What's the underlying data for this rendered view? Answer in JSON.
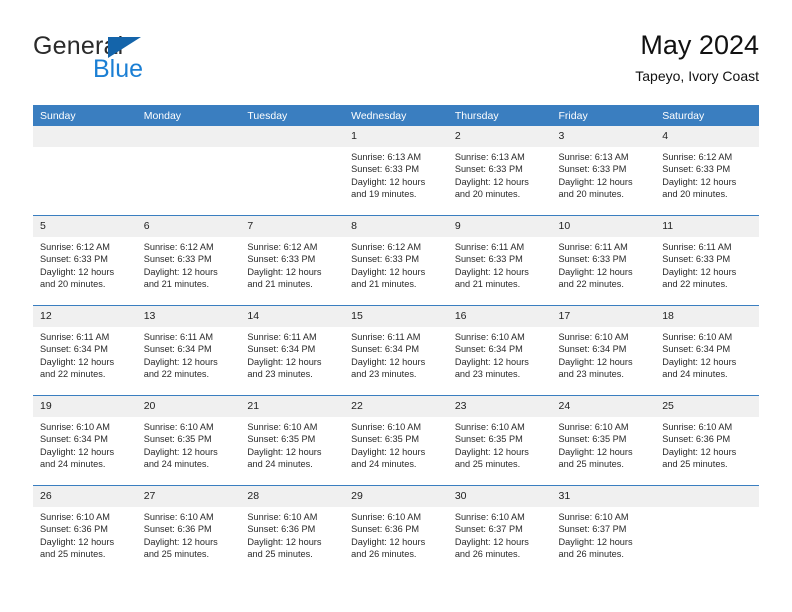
{
  "brand": {
    "name_part1": "General",
    "name_part2": "Blue",
    "triangle_icon": "blue-triangle-icon",
    "accent_color": "#1b7fd4"
  },
  "header": {
    "title": "May 2024",
    "subtitle": "Tapeyo, Ivory Coast"
  },
  "theme": {
    "header_row_bg": "#3a7ec0",
    "daynum_bg": "#f0f0f0",
    "grid_line": "#3a7ec0",
    "text": "#2a2a2a"
  },
  "weekdays": [
    "Sunday",
    "Monday",
    "Tuesday",
    "Wednesday",
    "Thursday",
    "Friday",
    "Saturday"
  ],
  "weeks": [
    [
      {
        "day": "",
        "sunrise": "",
        "sunset": "",
        "daylight": "",
        "empty": true
      },
      {
        "day": "",
        "sunrise": "",
        "sunset": "",
        "daylight": "",
        "empty": true
      },
      {
        "day": "",
        "sunrise": "",
        "sunset": "",
        "daylight": "",
        "empty": true
      },
      {
        "day": "1",
        "sunrise": "Sunrise: 6:13 AM",
        "sunset": "Sunset: 6:33 PM",
        "daylight": "Daylight: 12 hours and 19 minutes.",
        "empty": false
      },
      {
        "day": "2",
        "sunrise": "Sunrise: 6:13 AM",
        "sunset": "Sunset: 6:33 PM",
        "daylight": "Daylight: 12 hours and 20 minutes.",
        "empty": false
      },
      {
        "day": "3",
        "sunrise": "Sunrise: 6:13 AM",
        "sunset": "Sunset: 6:33 PM",
        "daylight": "Daylight: 12 hours and 20 minutes.",
        "empty": false
      },
      {
        "day": "4",
        "sunrise": "Sunrise: 6:12 AM",
        "sunset": "Sunset: 6:33 PM",
        "daylight": "Daylight: 12 hours and 20 minutes.",
        "empty": false
      }
    ],
    [
      {
        "day": "5",
        "sunrise": "Sunrise: 6:12 AM",
        "sunset": "Sunset: 6:33 PM",
        "daylight": "Daylight: 12 hours and 20 minutes.",
        "empty": false
      },
      {
        "day": "6",
        "sunrise": "Sunrise: 6:12 AM",
        "sunset": "Sunset: 6:33 PM",
        "daylight": "Daylight: 12 hours and 21 minutes.",
        "empty": false
      },
      {
        "day": "7",
        "sunrise": "Sunrise: 6:12 AM",
        "sunset": "Sunset: 6:33 PM",
        "daylight": "Daylight: 12 hours and 21 minutes.",
        "empty": false
      },
      {
        "day": "8",
        "sunrise": "Sunrise: 6:12 AM",
        "sunset": "Sunset: 6:33 PM",
        "daylight": "Daylight: 12 hours and 21 minutes.",
        "empty": false
      },
      {
        "day": "9",
        "sunrise": "Sunrise: 6:11 AM",
        "sunset": "Sunset: 6:33 PM",
        "daylight": "Daylight: 12 hours and 21 minutes.",
        "empty": false
      },
      {
        "day": "10",
        "sunrise": "Sunrise: 6:11 AM",
        "sunset": "Sunset: 6:33 PM",
        "daylight": "Daylight: 12 hours and 22 minutes.",
        "empty": false
      },
      {
        "day": "11",
        "sunrise": "Sunrise: 6:11 AM",
        "sunset": "Sunset: 6:33 PM",
        "daylight": "Daylight: 12 hours and 22 minutes.",
        "empty": false
      }
    ],
    [
      {
        "day": "12",
        "sunrise": "Sunrise: 6:11 AM",
        "sunset": "Sunset: 6:34 PM",
        "daylight": "Daylight: 12 hours and 22 minutes.",
        "empty": false
      },
      {
        "day": "13",
        "sunrise": "Sunrise: 6:11 AM",
        "sunset": "Sunset: 6:34 PM",
        "daylight": "Daylight: 12 hours and 22 minutes.",
        "empty": false
      },
      {
        "day": "14",
        "sunrise": "Sunrise: 6:11 AM",
        "sunset": "Sunset: 6:34 PM",
        "daylight": "Daylight: 12 hours and 23 minutes.",
        "empty": false
      },
      {
        "day": "15",
        "sunrise": "Sunrise: 6:11 AM",
        "sunset": "Sunset: 6:34 PM",
        "daylight": "Daylight: 12 hours and 23 minutes.",
        "empty": false
      },
      {
        "day": "16",
        "sunrise": "Sunrise: 6:10 AM",
        "sunset": "Sunset: 6:34 PM",
        "daylight": "Daylight: 12 hours and 23 minutes.",
        "empty": false
      },
      {
        "day": "17",
        "sunrise": "Sunrise: 6:10 AM",
        "sunset": "Sunset: 6:34 PM",
        "daylight": "Daylight: 12 hours and 23 minutes.",
        "empty": false
      },
      {
        "day": "18",
        "sunrise": "Sunrise: 6:10 AM",
        "sunset": "Sunset: 6:34 PM",
        "daylight": "Daylight: 12 hours and 24 minutes.",
        "empty": false
      }
    ],
    [
      {
        "day": "19",
        "sunrise": "Sunrise: 6:10 AM",
        "sunset": "Sunset: 6:34 PM",
        "daylight": "Daylight: 12 hours and 24 minutes.",
        "empty": false
      },
      {
        "day": "20",
        "sunrise": "Sunrise: 6:10 AM",
        "sunset": "Sunset: 6:35 PM",
        "daylight": "Daylight: 12 hours and 24 minutes.",
        "empty": false
      },
      {
        "day": "21",
        "sunrise": "Sunrise: 6:10 AM",
        "sunset": "Sunset: 6:35 PM",
        "daylight": "Daylight: 12 hours and 24 minutes.",
        "empty": false
      },
      {
        "day": "22",
        "sunrise": "Sunrise: 6:10 AM",
        "sunset": "Sunset: 6:35 PM",
        "daylight": "Daylight: 12 hours and 24 minutes.",
        "empty": false
      },
      {
        "day": "23",
        "sunrise": "Sunrise: 6:10 AM",
        "sunset": "Sunset: 6:35 PM",
        "daylight": "Daylight: 12 hours and 25 minutes.",
        "empty": false
      },
      {
        "day": "24",
        "sunrise": "Sunrise: 6:10 AM",
        "sunset": "Sunset: 6:35 PM",
        "daylight": "Daylight: 12 hours and 25 minutes.",
        "empty": false
      },
      {
        "day": "25",
        "sunrise": "Sunrise: 6:10 AM",
        "sunset": "Sunset: 6:36 PM",
        "daylight": "Daylight: 12 hours and 25 minutes.",
        "empty": false
      }
    ],
    [
      {
        "day": "26",
        "sunrise": "Sunrise: 6:10 AM",
        "sunset": "Sunset: 6:36 PM",
        "daylight": "Daylight: 12 hours and 25 minutes.",
        "empty": false
      },
      {
        "day": "27",
        "sunrise": "Sunrise: 6:10 AM",
        "sunset": "Sunset: 6:36 PM",
        "daylight": "Daylight: 12 hours and 25 minutes.",
        "empty": false
      },
      {
        "day": "28",
        "sunrise": "Sunrise: 6:10 AM",
        "sunset": "Sunset: 6:36 PM",
        "daylight": "Daylight: 12 hours and 25 minutes.",
        "empty": false
      },
      {
        "day": "29",
        "sunrise": "Sunrise: 6:10 AM",
        "sunset": "Sunset: 6:36 PM",
        "daylight": "Daylight: 12 hours and 26 minutes.",
        "empty": false
      },
      {
        "day": "30",
        "sunrise": "Sunrise: 6:10 AM",
        "sunset": "Sunset: 6:37 PM",
        "daylight": "Daylight: 12 hours and 26 minutes.",
        "empty": false
      },
      {
        "day": "31",
        "sunrise": "Sunrise: 6:10 AM",
        "sunset": "Sunset: 6:37 PM",
        "daylight": "Daylight: 12 hours and 26 minutes.",
        "empty": false
      },
      {
        "day": "",
        "sunrise": "",
        "sunset": "",
        "daylight": "",
        "empty": true
      }
    ]
  ]
}
